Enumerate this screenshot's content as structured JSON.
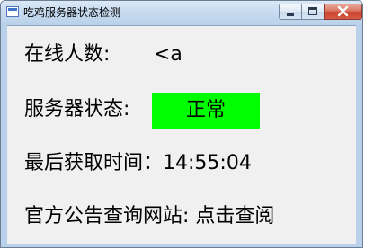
{
  "window": {
    "title": "吃鸡服务器状态检测"
  },
  "content": {
    "online_label": "在线人数:",
    "online_value": "<a",
    "status_label": "服务器状态:",
    "status_value": "正常",
    "last_label": "最后获取时间：",
    "last_value": "14:55:04",
    "site_label": "官方公告查询网站:",
    "site_link": "点击查阅"
  },
  "colors": {
    "status_ok": "#00ff00",
    "client_bg": "#f0f0f0",
    "frame": "#b9d1ea",
    "close_button": "#c8442c"
  },
  "icons": {
    "app": "app-window-icon",
    "minimize": "minimize-icon",
    "maximize": "maximize-icon",
    "close": "close-icon"
  }
}
